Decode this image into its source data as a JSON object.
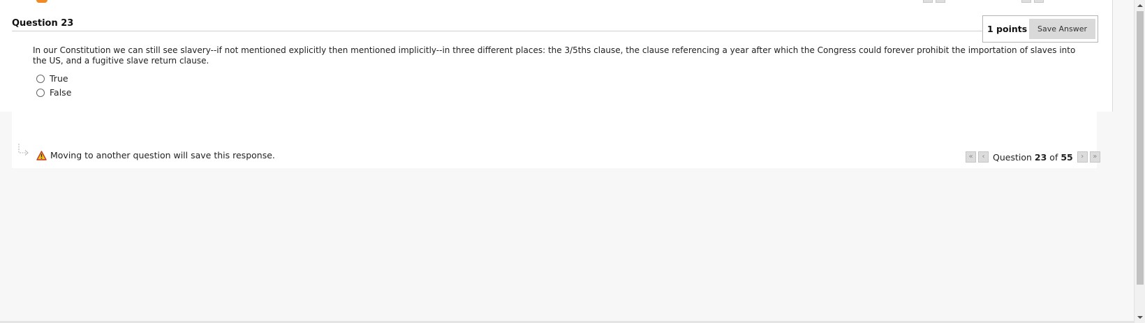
{
  "question": {
    "title": "Question 23",
    "points_label": "1 points",
    "save_label": "Save Answer",
    "text": "In our Constitution we can still see slavery--if not mentioned explicitly then mentioned implicitly--in three different places: the 3/5ths clause, the clause referencing a year after which the Congress could forever prohibit the importation of slaves into the US, and a fugitive slave return clause.",
    "options": [
      {
        "label": "True",
        "selected": false
      },
      {
        "label": "False",
        "selected": false
      }
    ]
  },
  "footer": {
    "warning_text": "Moving to another question will save this response.",
    "nav": {
      "prefix": "Question",
      "current": "23",
      "of_word": "of",
      "total": "55"
    }
  },
  "icons": {
    "warning": "warning-icon",
    "first": "first-page-icon",
    "prev": "previous-icon",
    "next": "next-icon",
    "last": "last-page-icon"
  },
  "colors": {
    "accent_orange": "#f08a24",
    "nav_button": "#dcdcdc"
  }
}
